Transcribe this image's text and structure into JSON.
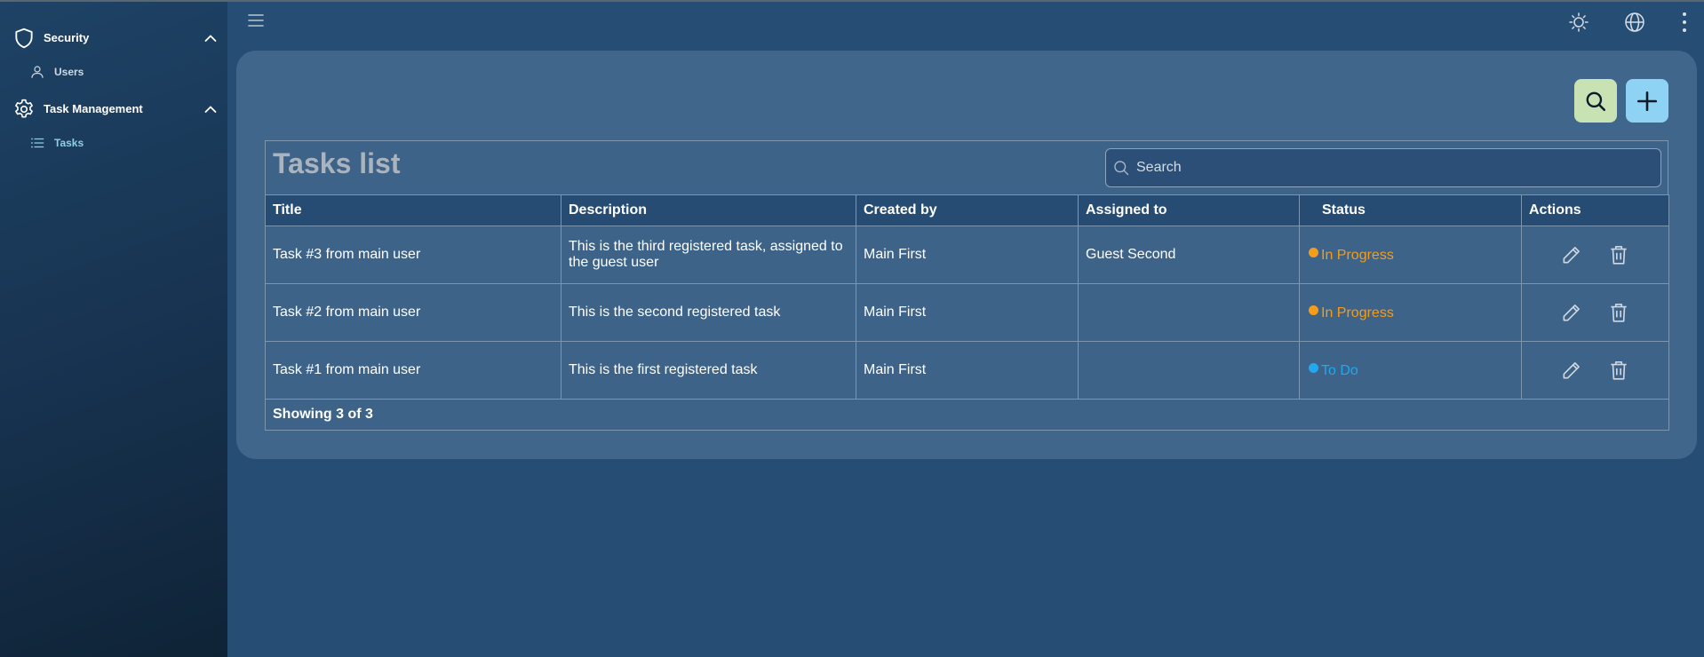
{
  "sidebar": {
    "groups": [
      {
        "label": "Security",
        "icon": "shield-icon",
        "items": [
          {
            "label": "Users",
            "icon": "user-icon"
          }
        ]
      },
      {
        "label": "Task Management",
        "icon": "gear-icon",
        "items": [
          {
            "label": "Tasks",
            "icon": "list-icon"
          }
        ]
      }
    ]
  },
  "topbar": {
    "menu_icon": "hamburger-icon",
    "theme_icon": "sun-icon",
    "language_icon": "globe-icon",
    "more_icon": "more-vertical-icon"
  },
  "toolbar": {
    "search_icon": "search-icon",
    "add_icon": "plus-icon"
  },
  "tasks": {
    "title": "Tasks list",
    "search": {
      "placeholder": "Search",
      "value": ""
    },
    "columns": [
      "Title",
      "Description",
      "Created by",
      "Assigned to",
      "Status",
      "Actions"
    ],
    "rows": [
      {
        "title": "Task #3 from main user",
        "description": "This is the third registered task, assigned to the guest user",
        "created_by": "Main First",
        "assigned_to": "Guest Second",
        "status": "In Progress"
      },
      {
        "title": "Task #2 from main user",
        "description": "This is the second registered task",
        "created_by": "Main First",
        "assigned_to": "",
        "status": "In Progress"
      },
      {
        "title": "Task #1 from main user",
        "description": "This is the first registered task",
        "created_by": "Main First",
        "assigned_to": "",
        "status": "To Do"
      }
    ],
    "footer": "Showing 3 of 3"
  },
  "colors": {
    "in_progress": "#f59c1a",
    "to_do": "#21a8ee",
    "search_button": "#c8e2b3",
    "add_button": "#8ed3f4",
    "active_nav": "#8ecfe6"
  }
}
